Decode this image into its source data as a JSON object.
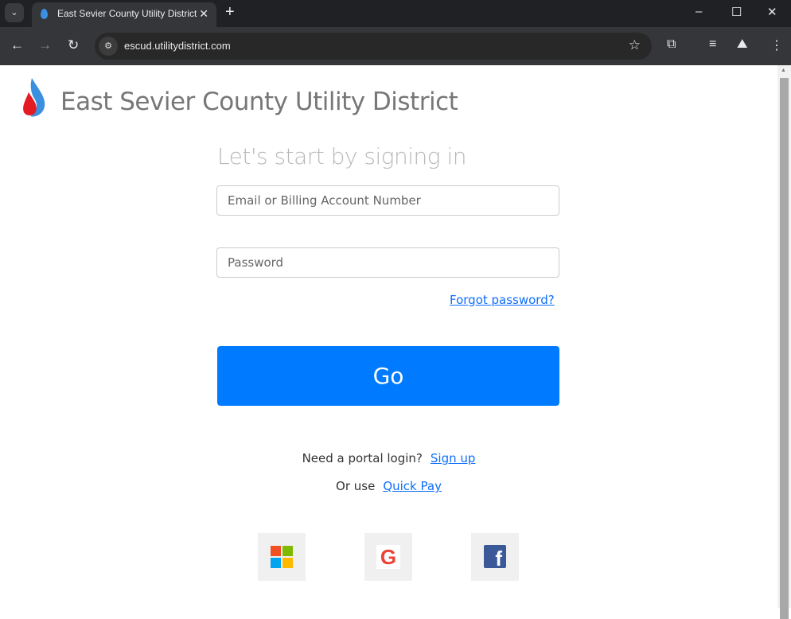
{
  "browser": {
    "tab_title": "East Sevier County Utility District",
    "url": "escud.utilitydistrict.com"
  },
  "header": {
    "brand": "East Sevier County Utility District"
  },
  "form": {
    "heading": "Let's start by signing in",
    "email_placeholder": "Email or Billing Account Number",
    "password_placeholder": "Password",
    "forgot": "Forgot password?",
    "go": "Go"
  },
  "links": {
    "signup_prompt": "Need a portal login?",
    "signup": "Sign up",
    "quickpay_prompt": "Or use",
    "quickpay": "Quick Pay"
  },
  "colors": {
    "accent": "#007bff",
    "link": "#0d6efd",
    "facebook": "#3b5998"
  },
  "social": [
    "microsoft-login",
    "google-login",
    "facebook-login"
  ]
}
